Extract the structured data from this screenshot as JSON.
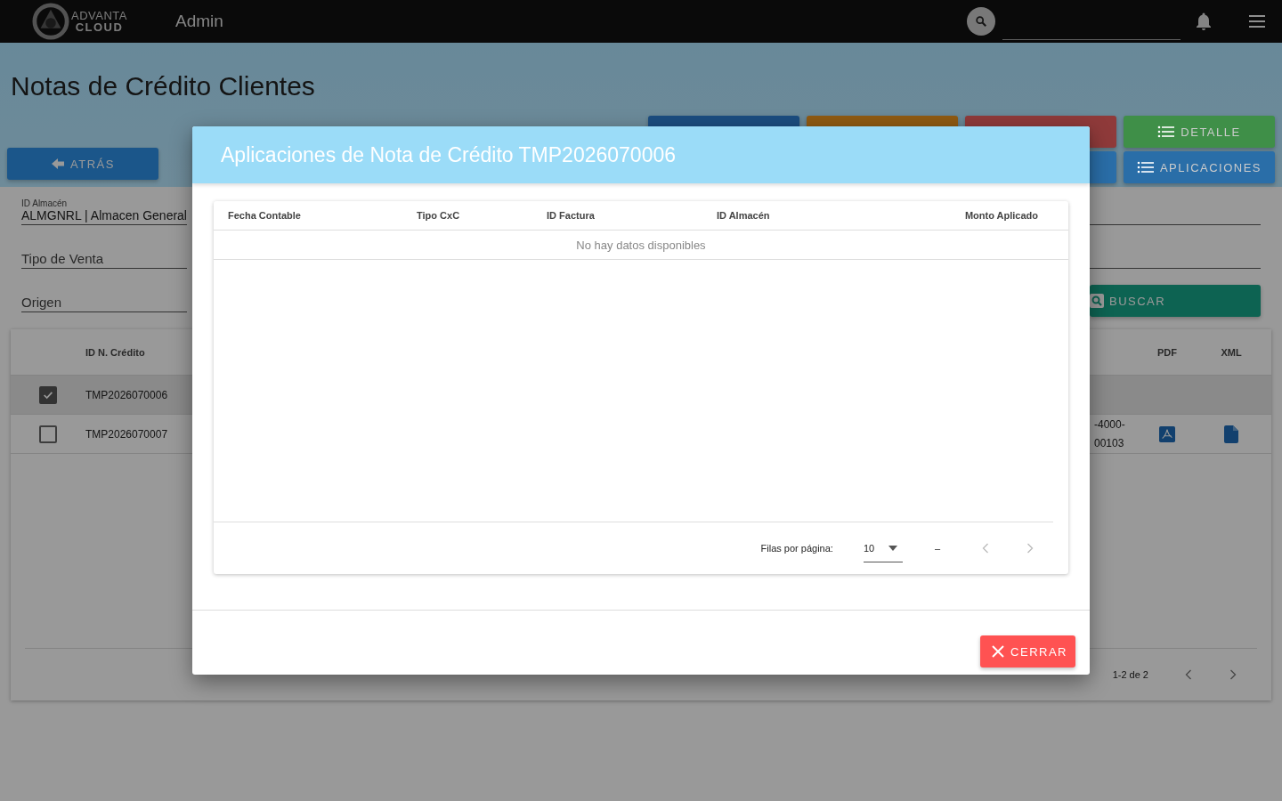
{
  "nav": {
    "logo_top": "ADVANTA",
    "logo_bottom": "CLOUD",
    "section": "Admin"
  },
  "page": {
    "title": "Notas de Crédito Clientes",
    "back_button": "ATRÁS",
    "action_buttons": [
      {
        "kind": "hidden",
        "color": "#1b4d80"
      },
      {
        "kind": "hidden",
        "color": "#8f5a12"
      },
      {
        "kind": "hidden",
        "color": "#8f3a3a"
      },
      {
        "kind": "list",
        "label": "DETALLE",
        "color": "#3f8f48"
      },
      {
        "kind": "spacer"
      },
      {
        "kind": "spacer"
      },
      {
        "kind": "hidden",
        "color": "#2a6ea8"
      },
      {
        "kind": "list",
        "label": "APLICACIONES",
        "color": "#2a6ea8"
      }
    ],
    "filters": [
      {
        "label": "ID Almacén",
        "value": "ALMGNRL | Almacen General"
      },
      {
        "placeholder": "Tipo de Venta"
      },
      {
        "placeholder": "Origen"
      }
    ],
    "search_button": "BUSCAR",
    "table": {
      "columns": {
        "id": "ID N. Crédito",
        "pdf": "PDF",
        "xml": "XML"
      },
      "rows": [
        {
          "checked": true,
          "id": "TMP2026070006"
        },
        {
          "checked": false,
          "id": "TMP2026070007",
          "column_3": [
            "-4000-",
            "00103"
          ],
          "pdf": true,
          "xml": true
        }
      ],
      "range": "1-2 de 2"
    }
  },
  "dialog": {
    "title": "Aplicaciones de Nota de Crédito TMP2026070006",
    "columns": [
      "Fecha Contable",
      "Tipo CxC",
      "ID Factura",
      "ID Almacén",
      "Monto Aplicado"
    ],
    "empty_message": "No hay datos disponibles",
    "rows_per_page_label": "Filas por página:",
    "rows_per_page": "10",
    "range": "–",
    "close_button": "CERRAR"
  }
}
